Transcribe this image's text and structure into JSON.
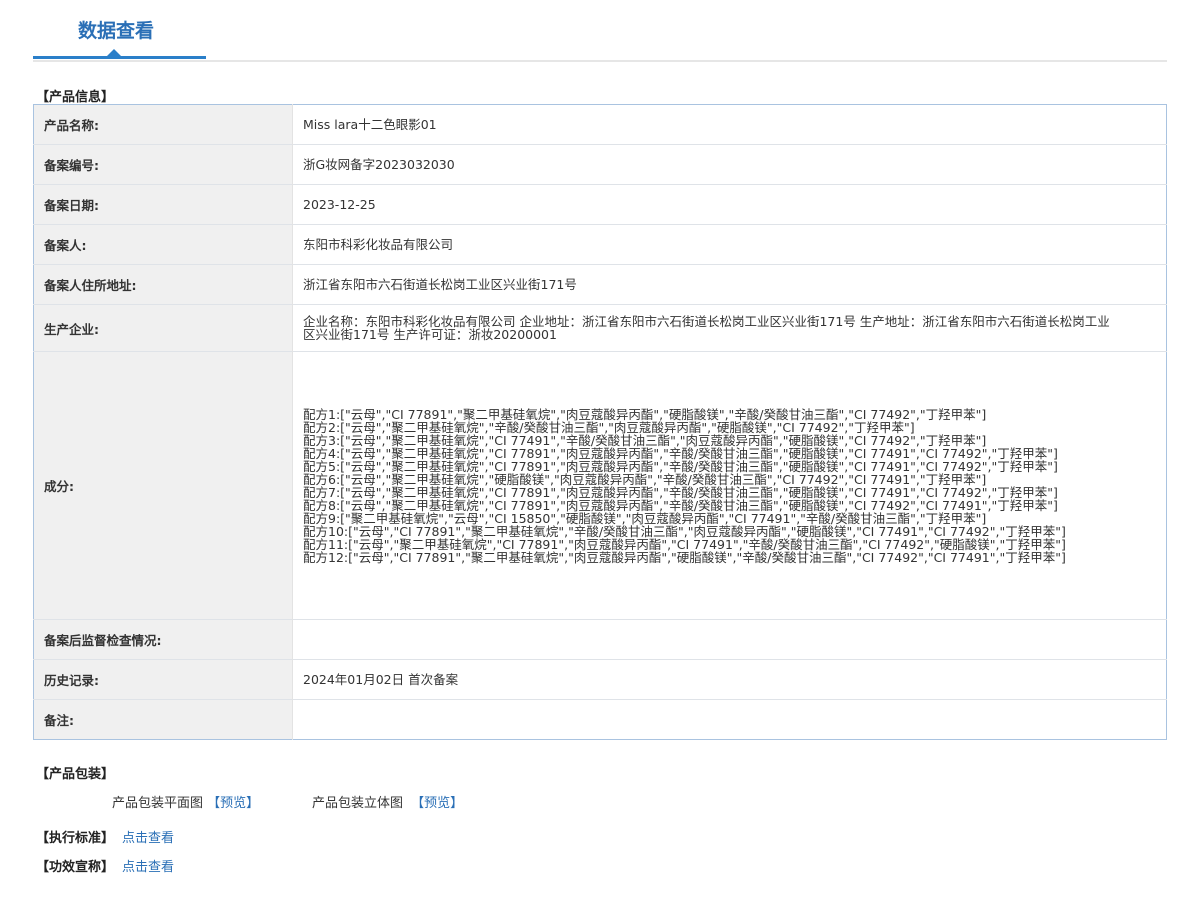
{
  "header": {
    "title": "数据查看"
  },
  "sections": {
    "product_info": "【产品信息】",
    "product_package": "【产品包装】",
    "exec_standard": "【执行标准】",
    "efficacy_claim": "【功效宣称】"
  },
  "product": {
    "name_label": "产品名称:",
    "name_value": "Miss lara十二色眼影01",
    "record_no_label": "备案编号:",
    "record_no_value": "浙G妆网备字2023032030",
    "record_date_label": "备案日期:",
    "record_date_value": "2023-12-25",
    "registrant_label": "备案人:",
    "registrant_value": "东阳市科彩化妆品有限公司",
    "address_label": "备案人住所地址:",
    "address_value": "浙江省东阳市六石街道长松岗工业区兴业街171号",
    "producer_label": "生产企业:",
    "producer_value": "企业名称：东阳市科彩化妆品有限公司 企业地址：浙江省东阳市六石街道长松岗工业区兴业街171号 生产地址：浙江省东阳市六石街道长松岗工业区兴业街171号 生产许可证：浙妆20200001",
    "ingredients_label": "成分:",
    "ingredients": [
      "配方1:[\"云母\",\"CI 77891\",\"聚二甲基硅氧烷\",\"肉豆蔻酸异丙酯\",\"硬脂酸镁\",\"辛酸/癸酸甘油三酯\",\"CI 77492\",\"丁羟甲苯\"]",
      "配方2:[\"云母\",\"聚二甲基硅氧烷\",\"辛酸/癸酸甘油三酯\",\"肉豆蔻酸异丙酯\",\"硬脂酸镁\",\"CI 77492\",\"丁羟甲苯\"]",
      "配方3:[\"云母\",\"聚二甲基硅氧烷\",\"CI 77491\",\"辛酸/癸酸甘油三酯\",\"肉豆蔻酸异丙酯\",\"硬脂酸镁\",\"CI 77492\",\"丁羟甲苯\"]",
      "配方4:[\"云母\",\"聚二甲基硅氧烷\",\"CI 77891\",\"肉豆蔻酸异丙酯\",\"辛酸/癸酸甘油三酯\",\"硬脂酸镁\",\"CI 77491\",\"CI 77492\",\"丁羟甲苯\"]",
      "配方5:[\"云母\",\"聚二甲基硅氧烷\",\"CI 77891\",\"肉豆蔻酸异丙酯\",\"辛酸/癸酸甘油三酯\",\"硬脂酸镁\",\"CI 77491\",\"CI 77492\",\"丁羟甲苯\"]",
      "配方6:[\"云母\",\"聚二甲基硅氧烷\",\"硬脂酸镁\",\"肉豆蔻酸异丙酯\",\"辛酸/癸酸甘油三酯\",\"CI 77492\",\"CI 77491\",\"丁羟甲苯\"]",
      "配方7:[\"云母\",\"聚二甲基硅氧烷\",\"CI 77891\",\"肉豆蔻酸异丙酯\",\"辛酸/癸酸甘油三酯\",\"硬脂酸镁\",\"CI 77491\",\"CI 77492\",\"丁羟甲苯\"]",
      "配方8:[\"云母\",\"聚二甲基硅氧烷\",\"CI 77891\",\"肉豆蔻酸异丙酯\",\"辛酸/癸酸甘油三酯\",\"硬脂酸镁\",\"CI 77492\",\"CI 77491\",\"丁羟甲苯\"]",
      "配方9:[\"聚二甲基硅氧烷\",\"云母\",\"CI 15850\",\"硬脂酸镁\",\"肉豆蔻酸异丙酯\",\"CI 77491\",\"辛酸/癸酸甘油三酯\",\"丁羟甲苯\"]",
      "配方10:[\"云母\",\"CI 77891\",\"聚二甲基硅氧烷\",\"辛酸/癸酸甘油三酯\",\"肉豆蔻酸异丙酯\",\"硬脂酸镁\",\"CI 77491\",\"CI 77492\",\"丁羟甲苯\"]",
      "配方11:[\"云母\",\"聚二甲基硅氧烷\",\"CI 77891\",\"肉豆蔻酸异丙酯\",\"CI 77491\",\"辛酸/癸酸甘油三酯\",\"CI 77492\",\"硬脂酸镁\",\"丁羟甲苯\"]",
      "配方12:[\"云母\",\"CI 77891\",\"聚二甲基硅氧烷\",\"肉豆蔻酸异丙酯\",\"硬脂酸镁\",\"辛酸/癸酸甘油三酯\",\"CI 77492\",\"CI 77491\",\"丁羟甲苯\"]"
    ],
    "supervision_label": "备案后监督检查情况:",
    "supervision_value": "",
    "history_label": "历史记录:",
    "history_value": "2024年01月02日 首次备案",
    "remark_label": "备注:",
    "remark_value": ""
  },
  "package": {
    "flat_label": "产品包装平面图",
    "flat_link": "【预览】",
    "solid_label": "产品包装立体图",
    "solid_link": "【预览】"
  },
  "links": {
    "view_label": "点击查看"
  }
}
